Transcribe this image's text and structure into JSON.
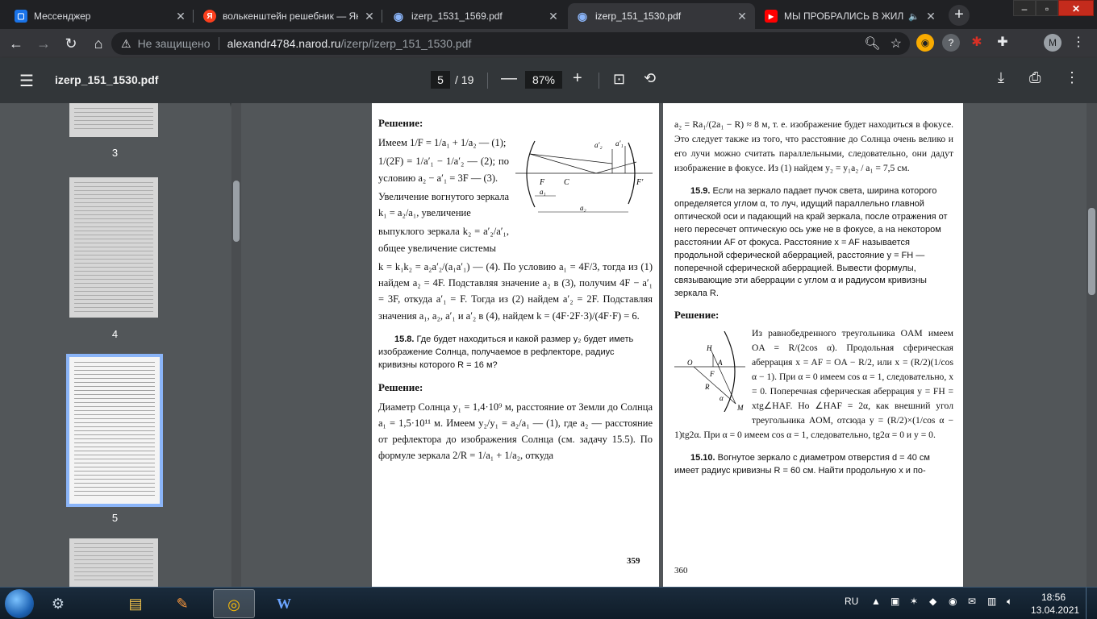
{
  "browser": {
    "tabs": [
      {
        "title": "Мессенджер",
        "icon": "messenger-icon",
        "color": "#1a73e8",
        "active": false
      },
      {
        "title": "волькенштейн решебник — Ян",
        "icon": "yandex-icon",
        "color": "#fc3f1d",
        "active": false
      },
      {
        "title": "izerp_1531_1569.pdf",
        "icon": "pdf-globe-icon",
        "color": "#8ab4f8",
        "active": false
      },
      {
        "title": "izerp_151_1530.pdf",
        "icon": "pdf-globe-icon",
        "color": "#8ab4f8",
        "active": true
      },
      {
        "title": "МЫ ПРОБРАЛИСЬ В ЖИЛ",
        "icon": "youtube-icon",
        "color": "#ff0000",
        "active": false
      }
    ],
    "omnibox": {
      "security_label": "Не защищено",
      "url_host": "alexandr4784.narod.ru",
      "url_path": "/izerp/izerp_151_1530.pdf"
    },
    "profile_initial": "M"
  },
  "pdf_viewer": {
    "file_name": "izerp_151_1530.pdf",
    "current_page": "5",
    "total_pages": "/ 19",
    "zoom": "87%",
    "thumbnails": [
      {
        "label": "3",
        "selected": false
      },
      {
        "label": "4",
        "selected": false
      },
      {
        "label": "5",
        "selected": true
      }
    ]
  },
  "page_left": {
    "solution_heading": "Решение:",
    "para1_a": "Имеем 1/F = 1/a₁ + 1/a₂ — (1);",
    "para1_b": "1/(2F) = 1/a′₁ − 1/a′₂ — (2); по условию a₂ − a′₁ = 3F — (3).",
    "para1_c": "Увеличение вогнутого зеркала k₁ = a₂/a₁, увеличение",
    "para1_d": "выпуклого зеркала k₂ = a′₂/a′₁, общее увеличение системы",
    "para1_e": "k = k₁k₂ = a₂a′₂/(a₁a′₁) — (4). По условию a₁ = 4F/3, тогда из (1) найдем a₂ = 4F. Подставляя значение a₂ в (3), получим 4F − a′₁ = 3F, откуда a′₁ = F. Тогда из (2) найдем a′₂ = 2F. Подставляя значения a₁, a₂, a′₁ и a′₂ в (4), найдем k = (4F·2F·3)/(4F·F) = 6.",
    "problem_number": "15.8.",
    "problem_text": "Где будет находиться и какой размер y₂ будет иметь изображение Солнца, получаемое в рефлекторе, радиус кривизны которого R = 16 м?",
    "solution2_heading": "Решение:",
    "solution2_text": "Диаметр Солнца y₁ = 1,4·10⁹ м, расстояние от Земли до Солнца a₁ = 1,5·10¹¹ м. Имеем y₂/y₁ = a₂/a₁ — (1), где a₂ — расстояние от рефлектора до изображения Солнца (см. задачу 15.5). По формуле зеркала 2/R = 1/a₁ + 1/a₂, откуда",
    "page_number": "359",
    "figure_labels": {
      "F": "F",
      "C": "C",
      "F2": "F′",
      "a1": "a₁",
      "a2": "a₂",
      "a1p": "a′₁",
      "a2p": "a′₂"
    }
  },
  "page_right": {
    "top_text": "a₂ = Ra₁/(2a₁ − R) ≈ 8 м, т. е. изображение будет находиться в фокусе. Это следует также из того, что расстояние до Солнца очень велико и его лучи можно считать параллельными, следовательно, они дадут изображение в фокусе. Из (1) найдем y₂ = y₁a₂ / a₁ = 7,5 см.",
    "problem_number": "15.9.",
    "problem_text": "Если на зеркало падает пучок света, ширина которого определяется углом α, то луч, идущий параллельно главной оптической оси и падающий на край зеркала, после отражения от него пересечет оптическую ось уже не в фокусе, а на некотором расстоянии AF от фокуса. Расстояние x = AF называется продольной сферической аберрацией, расстояние y = FH — поперечной сферической аберрацией. Вывести формулы, связывающие эти аберрации с углом α и радиусом кривизны зеркала R.",
    "solution_heading": "Решение:",
    "solution_text": "Из равнобедренного треугольника OAM имеем OA = R/(2cos α). Продольная сферическая аберрация x = AF = OA − R/2, или x = (R/2)(1/cos α − 1). При α = 0 имеем cos α = 1, следовательно, x = 0. Поперечная сферическая аберрация y = FH = xtg∠HAF. Но ∠HAF = 2α, как внешний угол треугольника AOM, отсюда y = (R/2)×(1/cos α − 1)tg2α. При α = 0 имеем cos α = 1, следовательно, tg2α = 0 и y = 0.",
    "next_problem_number": "15.10.",
    "next_problem_text": "Вогнутое зеркало с диаметром отверстия d = 40 см имеет радиус кривизны R = 60 см. Найти продольную x и по-",
    "page_number": "360",
    "figure_labels": {
      "H": "H",
      "O": "O",
      "A": "A",
      "F": "F",
      "R": "R",
      "M": "M",
      "alpha": "α"
    }
  },
  "taskbar": {
    "language": "RU",
    "time": "18:56",
    "date": "13.04.2021"
  }
}
